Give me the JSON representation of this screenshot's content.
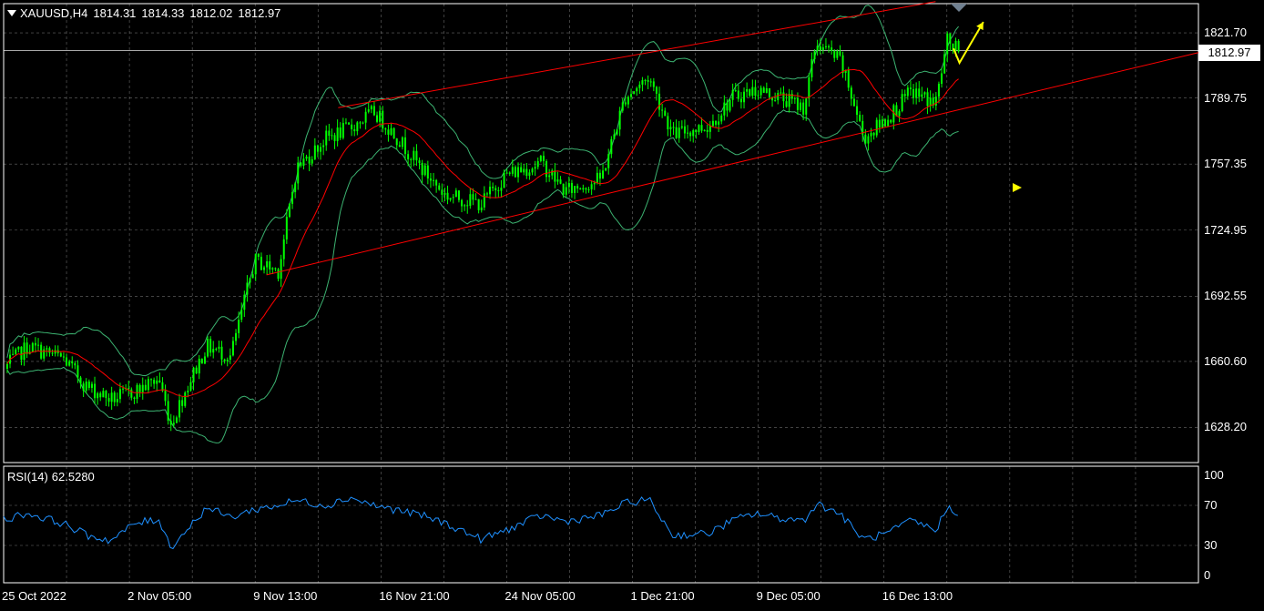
{
  "header": {
    "symbol": "XAUUSD,H4",
    "open": "1814.31",
    "high": "1814.33",
    "low": "1812.02",
    "close": "1812.97"
  },
  "rsi_header": {
    "name": "RSI(14)",
    "value": "62.5280"
  },
  "current_price_label": "1812.97",
  "colors": {
    "background": "#000000",
    "grid": "#c0c0c0",
    "candles": "#00ff00",
    "bollinger": "#3cb371",
    "ma": "#ff0000",
    "channel": "#ff0000",
    "rsi": "#1e90ff",
    "arrow": "#ffff00"
  },
  "chart_data": [
    {
      "type": "candlestick",
      "title": "XAUUSD,H4",
      "ylim": [
        1611,
        1836
      ],
      "y_ticks": [
        "1821.70",
        "1789.75",
        "1757.35",
        "1724.95",
        "1692.55",
        "1660.60",
        "1628.20"
      ],
      "x_ticks": [
        "25 Oct 2022",
        "2 Nov 05:00",
        "9 Nov 13:00",
        "16 Nov 21:00",
        "24 Nov 05:00",
        "1 Dec 21:00",
        "9 Dec 05:00",
        "16 Dec 13:00"
      ],
      "grid": true,
      "close_path": [
        {
          "t": 0.0,
          "v": 1657
        },
        {
          "t": 0.02,
          "v": 1668
        },
        {
          "t": 0.05,
          "v": 1662
        },
        {
          "t": 0.07,
          "v": 1648
        },
        {
          "t": 0.09,
          "v": 1642
        },
        {
          "t": 0.11,
          "v": 1646
        },
        {
          "t": 0.13,
          "v": 1652
        },
        {
          "t": 0.14,
          "v": 1630
        },
        {
          "t": 0.155,
          "v": 1650
        },
        {
          "t": 0.17,
          "v": 1668
        },
        {
          "t": 0.19,
          "v": 1663
        },
        {
          "t": 0.21,
          "v": 1710
        },
        {
          "t": 0.23,
          "v": 1705
        },
        {
          "t": 0.245,
          "v": 1755
        },
        {
          "t": 0.27,
          "v": 1770
        },
        {
          "t": 0.29,
          "v": 1775
        },
        {
          "t": 0.31,
          "v": 1783
        },
        {
          "t": 0.33,
          "v": 1770
        },
        {
          "t": 0.35,
          "v": 1755
        },
        {
          "t": 0.37,
          "v": 1742
        },
        {
          "t": 0.4,
          "v": 1738
        },
        {
          "t": 0.42,
          "v": 1752
        },
        {
          "t": 0.45,
          "v": 1758
        },
        {
          "t": 0.47,
          "v": 1744
        },
        {
          "t": 0.5,
          "v": 1750
        },
        {
          "t": 0.52,
          "v": 1790
        },
        {
          "t": 0.54,
          "v": 1800
        },
        {
          "t": 0.56,
          "v": 1772
        },
        {
          "t": 0.59,
          "v": 1776
        },
        {
          "t": 0.61,
          "v": 1790
        },
        {
          "t": 0.63,
          "v": 1794
        },
        {
          "t": 0.65,
          "v": 1790
        },
        {
          "t": 0.67,
          "v": 1785
        },
        {
          "t": 0.68,
          "v": 1817
        },
        {
          "t": 0.7,
          "v": 1808
        },
        {
          "t": 0.71,
          "v": 1790
        },
        {
          "t": 0.72,
          "v": 1770
        },
        {
          "t": 0.74,
          "v": 1780
        },
        {
          "t": 0.76,
          "v": 1793
        },
        {
          "t": 0.78,
          "v": 1787
        },
        {
          "t": 0.79,
          "v": 1818
        },
        {
          "t": 0.8,
          "v": 1812
        }
      ],
      "channel_lines": [
        {
          "from": {
            "t": 0.28,
            "v": 1785
          },
          "to": {
            "t": 0.78,
            "v": 1837
          }
        },
        {
          "from": {
            "t": 0.22,
            "v": 1703
          },
          "to": {
            "t": 1.0,
            "v": 1812
          }
        }
      ],
      "projection": [
        {
          "t": 0.795,
          "v": 1814
        },
        {
          "t": 0.8,
          "v": 1807
        },
        {
          "t": 0.82,
          "v": 1827
        }
      ]
    },
    {
      "type": "line",
      "title": "RSI(14)",
      "ylim": [
        0,
        100
      ],
      "y_ticks": [
        "100",
        "70",
        "30",
        "0"
      ],
      "grid": true,
      "series": [
        {
          "name": "RSI(14)",
          "x": [
            0.0,
            0.02,
            0.05,
            0.07,
            0.09,
            0.11,
            0.13,
            0.14,
            0.155,
            0.17,
            0.19,
            0.21,
            0.23,
            0.245,
            0.27,
            0.29,
            0.31,
            0.33,
            0.35,
            0.37,
            0.4,
            0.42,
            0.45,
            0.47,
            0.5,
            0.52,
            0.54,
            0.56,
            0.59,
            0.61,
            0.63,
            0.65,
            0.67,
            0.68,
            0.7,
            0.71,
            0.72,
            0.74,
            0.76,
            0.78,
            0.79,
            0.8
          ],
          "values": [
            56,
            62,
            52,
            40,
            35,
            52,
            56,
            28,
            48,
            68,
            58,
            66,
            70,
            75,
            70,
            78,
            70,
            65,
            60,
            52,
            36,
            45,
            60,
            54,
            60,
            72,
            76,
            40,
            42,
            55,
            62,
            57,
            55,
            72,
            62,
            48,
            36,
            42,
            55,
            45,
            68,
            62.5
          ]
        }
      ]
    }
  ]
}
